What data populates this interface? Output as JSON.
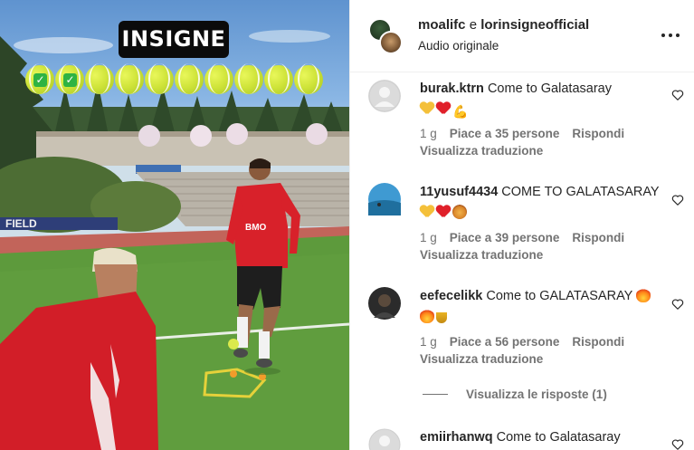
{
  "video": {
    "caption": "INSIGNE",
    "balls": [
      {
        "checked": true
      },
      {
        "checked": true
      },
      {
        "checked": false
      },
      {
        "checked": false
      },
      {
        "checked": false
      },
      {
        "checked": false
      },
      {
        "checked": false
      },
      {
        "checked": false
      },
      {
        "checked": false
      },
      {
        "checked": false
      }
    ],
    "check_glyph": "✓",
    "field_sign": "FIELD",
    "jersey_sponsor": "BMO"
  },
  "post": {
    "user1": "moalifc",
    "conjunction": "e",
    "user2": "lorinsigneofficial",
    "audio": "Audio originale"
  },
  "comments": [
    {
      "username": "burak.ktrn",
      "text": "Come to Galatasaray",
      "emojis": [
        "yellow-heart",
        "red-heart",
        "flexed-biceps"
      ],
      "time": "1 g",
      "likes": "Piace a 35 persone",
      "reply": "Rispondi",
      "translate": "Visualizza traduzione",
      "avatar_color": "#d9d9d9"
    },
    {
      "username": "11yusuf4434",
      "text": "COME TO GALATASARAY",
      "emojis": [
        "yellow-heart",
        "red-heart",
        "lion-face"
      ],
      "time": "1 g",
      "likes": "Piace a 39 persone",
      "reply": "Rispondi",
      "translate": "Visualizza traduzione",
      "avatar_color": "#3b8fc4"
    },
    {
      "username": "eefecelikk",
      "text": "Come to GALATASARAY",
      "emojis": [
        "fire",
        "fire",
        "trophy"
      ],
      "time": "1 g",
      "likes": "Piace a 56 persone",
      "reply": "Rispondi",
      "translate": "Visualizza traduzione",
      "avatar_color": "#2a2a2a"
    },
    {
      "username": "emiirhanwq",
      "text": "Come to Galatasaray",
      "avatar_color": "#d9d9d9"
    }
  ],
  "view_replies": "Visualizza le risposte (1)",
  "colors": {
    "text_primary": "#262626",
    "text_secondary": "#737373",
    "divider": "#efefef"
  }
}
